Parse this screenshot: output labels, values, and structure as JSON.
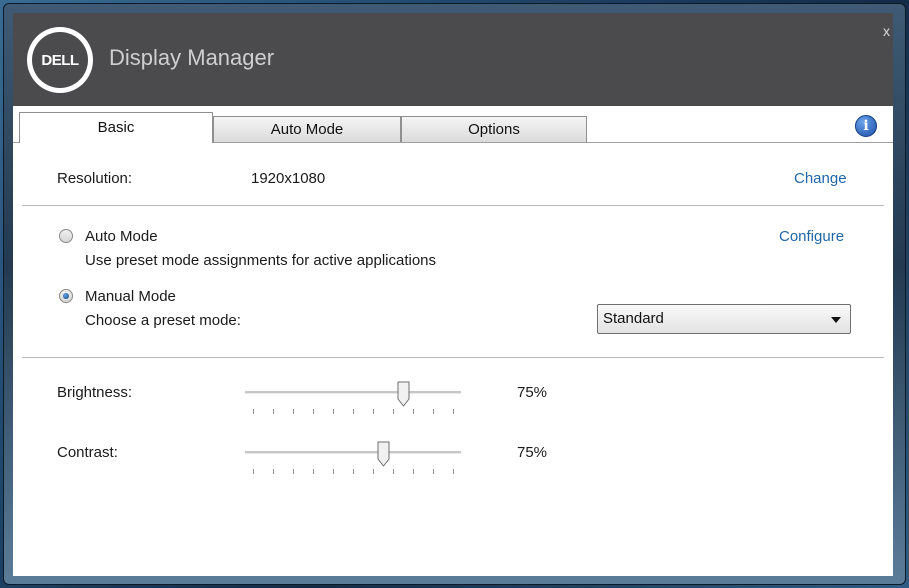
{
  "window": {
    "title": "Display Manager",
    "logo_text": "DELL",
    "close_label": "x"
  },
  "tabs": [
    {
      "label": "Basic",
      "active": true
    },
    {
      "label": "Auto Mode",
      "active": false
    },
    {
      "label": "Options",
      "active": false
    }
  ],
  "info_icon": {
    "glyph": "i",
    "icon": "info-icon"
  },
  "resolution": {
    "label": "Resolution:",
    "value": "1920x1080",
    "link": "Change"
  },
  "auto_mode": {
    "label": "Auto Mode",
    "description": "Use preset mode assignments for active applications",
    "link": "Configure",
    "selected": false
  },
  "manual_mode": {
    "label": "Manual Mode",
    "description": "Choose a preset mode:",
    "selected": true,
    "preset_value": "Standard"
  },
  "brightness": {
    "label": "Brightness:",
    "value_text": "75%",
    "level": 0.75
  },
  "contrast": {
    "label": "Contrast:",
    "value_text": "75%",
    "level": 0.65
  },
  "colors": {
    "titlebar": "#4b4b4d",
    "link": "#1f66a8",
    "panel": "#ffffff"
  }
}
